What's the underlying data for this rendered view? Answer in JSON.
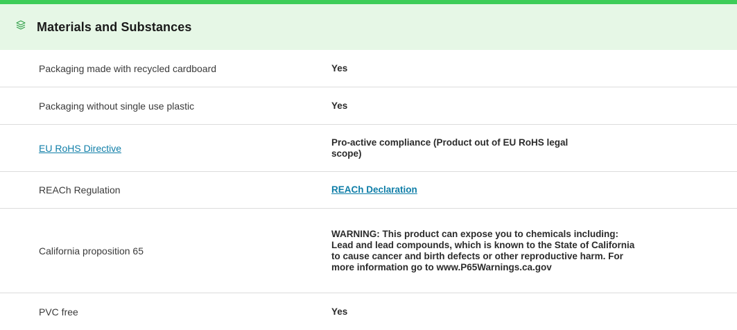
{
  "section": {
    "title": "Materials and Substances",
    "icon": "layers-icon",
    "accent_color": "#3dcd58",
    "header_bg": "#e6f7e6",
    "link_color": "#0f7ea8"
  },
  "rows": [
    {
      "label": "Packaging made with recycled cardboard",
      "value": "Yes"
    },
    {
      "label": "Packaging without single use plastic",
      "value": "Yes"
    },
    {
      "label": "EU RoHS Directive",
      "label_is_link": true,
      "value": "Pro-active compliance (Product out of EU RoHS legal scope)"
    },
    {
      "label": "REACh Regulation",
      "value": "REACh Declaration",
      "value_is_link": true
    },
    {
      "label": "California proposition 65",
      "value": "WARNING: This product can expose you to chemicals including: Lead and lead compounds, which is known to the State of California to cause cancer and birth defects or other reproductive harm. For more information go to www.P65Warnings.ca.gov"
    },
    {
      "label": "PVC free",
      "value": "Yes"
    }
  ]
}
